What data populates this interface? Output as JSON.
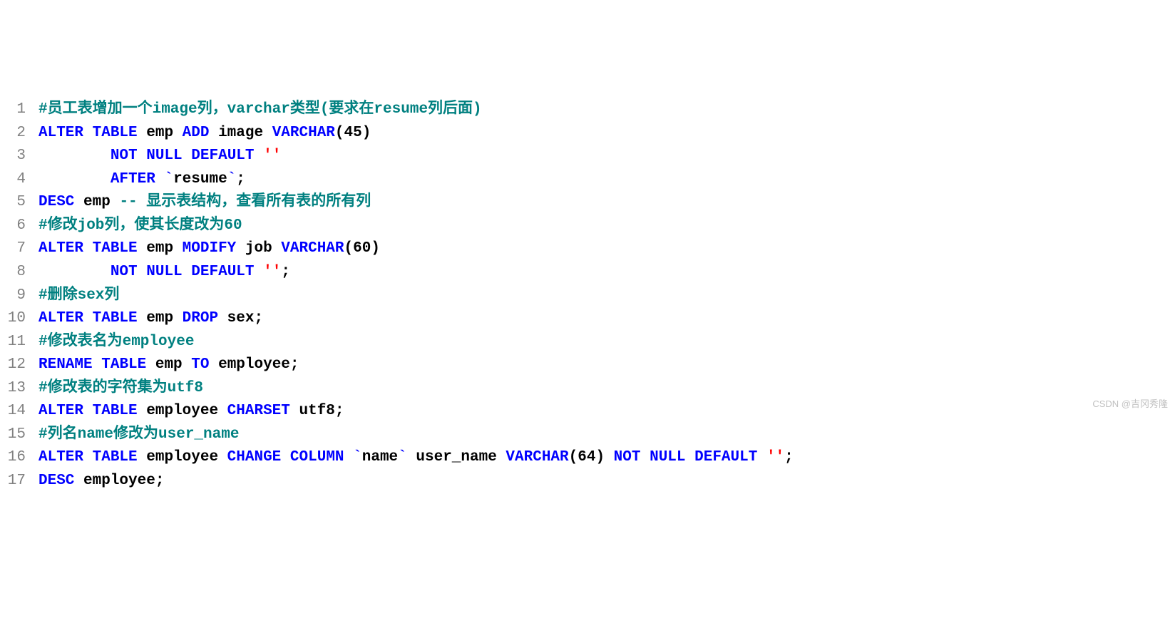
{
  "watermark": "CSDN @吉冈秀隆",
  "lines": [
    {
      "n": "1",
      "tokens": [
        {
          "c": "cmt",
          "t": "#员工表增加一个image列，varchar类型(要求在resume列后面)"
        }
      ]
    },
    {
      "n": "2",
      "tokens": [
        {
          "c": "kw",
          "t": "ALTER"
        },
        {
          "c": "txt",
          "t": " "
        },
        {
          "c": "kw",
          "t": "TABLE"
        },
        {
          "c": "txt",
          "t": " emp "
        },
        {
          "c": "kw",
          "t": "ADD"
        },
        {
          "c": "txt",
          "t": " image "
        },
        {
          "c": "kw",
          "t": "VARCHAR"
        },
        {
          "c": "txt",
          "t": "("
        },
        {
          "c": "num",
          "t": "45"
        },
        {
          "c": "txt",
          "t": ")"
        }
      ]
    },
    {
      "n": "3",
      "tokens": [
        {
          "c": "txt",
          "t": "        "
        },
        {
          "c": "kw",
          "t": "NOT"
        },
        {
          "c": "txt",
          "t": " "
        },
        {
          "c": "kw",
          "t": "NULL"
        },
        {
          "c": "txt",
          "t": " "
        },
        {
          "c": "kw",
          "t": "DEFAULT"
        },
        {
          "c": "txt",
          "t": " "
        },
        {
          "c": "str",
          "t": "''"
        }
      ]
    },
    {
      "n": "4",
      "tokens": [
        {
          "c": "txt",
          "t": "        "
        },
        {
          "c": "kw",
          "t": "AFTER"
        },
        {
          "c": "txt",
          "t": " "
        },
        {
          "c": "bk",
          "t": "`"
        },
        {
          "c": "txt",
          "t": "resume"
        },
        {
          "c": "bk",
          "t": "`"
        },
        {
          "c": "txt",
          "t": ";"
        }
      ]
    },
    {
      "n": "5",
      "tokens": [
        {
          "c": "kw",
          "t": "DESC"
        },
        {
          "c": "txt",
          "t": " emp "
        },
        {
          "c": "cmt",
          "t": "-- 显示表结构，查看所有表的所有列"
        }
      ]
    },
    {
      "n": "6",
      "tokens": [
        {
          "c": "cmt",
          "t": "#修改job列，使其长度改为60"
        }
      ]
    },
    {
      "n": "7",
      "tokens": [
        {
          "c": "kw",
          "t": "ALTER"
        },
        {
          "c": "txt",
          "t": " "
        },
        {
          "c": "kw",
          "t": "TABLE"
        },
        {
          "c": "txt",
          "t": " emp "
        },
        {
          "c": "kw",
          "t": "MODIFY"
        },
        {
          "c": "txt",
          "t": " job "
        },
        {
          "c": "kw",
          "t": "VARCHAR"
        },
        {
          "c": "txt",
          "t": "("
        },
        {
          "c": "num",
          "t": "60"
        },
        {
          "c": "txt",
          "t": ")"
        }
      ]
    },
    {
      "n": "8",
      "tokens": [
        {
          "c": "txt",
          "t": "        "
        },
        {
          "c": "kw",
          "t": "NOT"
        },
        {
          "c": "txt",
          "t": " "
        },
        {
          "c": "kw",
          "t": "NULL"
        },
        {
          "c": "txt",
          "t": " "
        },
        {
          "c": "kw",
          "t": "DEFAULT"
        },
        {
          "c": "txt",
          "t": " "
        },
        {
          "c": "str",
          "t": "''"
        },
        {
          "c": "txt",
          "t": ";"
        }
      ]
    },
    {
      "n": "9",
      "tokens": [
        {
          "c": "cmt",
          "t": "#删除sex列"
        }
      ]
    },
    {
      "n": "10",
      "tokens": [
        {
          "c": "kw",
          "t": "ALTER"
        },
        {
          "c": "txt",
          "t": " "
        },
        {
          "c": "kw",
          "t": "TABLE"
        },
        {
          "c": "txt",
          "t": " emp "
        },
        {
          "c": "kw",
          "t": "DROP"
        },
        {
          "c": "txt",
          "t": " sex;"
        }
      ]
    },
    {
      "n": "11",
      "tokens": [
        {
          "c": "cmt",
          "t": "#修改表名为employee"
        }
      ]
    },
    {
      "n": "12",
      "tokens": [
        {
          "c": "kw",
          "t": "RENAME"
        },
        {
          "c": "txt",
          "t": " "
        },
        {
          "c": "kw",
          "t": "TABLE"
        },
        {
          "c": "txt",
          "t": " emp "
        },
        {
          "c": "kw",
          "t": "TO"
        },
        {
          "c": "txt",
          "t": " employee;"
        }
      ]
    },
    {
      "n": "13",
      "tokens": [
        {
          "c": "cmt",
          "t": "#修改表的字符集为utf8"
        }
      ]
    },
    {
      "n": "14",
      "tokens": [
        {
          "c": "kw",
          "t": "ALTER"
        },
        {
          "c": "txt",
          "t": " "
        },
        {
          "c": "kw",
          "t": "TABLE"
        },
        {
          "c": "txt",
          "t": " employee "
        },
        {
          "c": "kw",
          "t": "CHARSET"
        },
        {
          "c": "txt",
          "t": " utf8;"
        }
      ]
    },
    {
      "n": "15",
      "tokens": [
        {
          "c": "cmt",
          "t": "#列名name修改为user_name"
        }
      ]
    },
    {
      "n": "16",
      "tokens": [
        {
          "c": "kw",
          "t": "ALTER"
        },
        {
          "c": "txt",
          "t": " "
        },
        {
          "c": "kw",
          "t": "TABLE"
        },
        {
          "c": "txt",
          "t": " employee "
        },
        {
          "c": "kw",
          "t": "CHANGE"
        },
        {
          "c": "txt",
          "t": " "
        },
        {
          "c": "kw",
          "t": "COLUMN"
        },
        {
          "c": "txt",
          "t": " "
        },
        {
          "c": "bk",
          "t": "`"
        },
        {
          "c": "txt",
          "t": "name"
        },
        {
          "c": "bk",
          "t": "`"
        },
        {
          "c": "txt",
          "t": " user_name "
        },
        {
          "c": "kw",
          "t": "VARCHAR"
        },
        {
          "c": "txt",
          "t": "("
        },
        {
          "c": "num",
          "t": "64"
        },
        {
          "c": "txt",
          "t": ") "
        },
        {
          "c": "kw",
          "t": "NOT"
        },
        {
          "c": "txt",
          "t": " "
        },
        {
          "c": "kw",
          "t": "NULL"
        },
        {
          "c": "txt",
          "t": " "
        },
        {
          "c": "kw",
          "t": "DEFAULT"
        },
        {
          "c": "txt",
          "t": " "
        },
        {
          "c": "str",
          "t": "''"
        },
        {
          "c": "txt",
          "t": ";"
        }
      ]
    },
    {
      "n": "17",
      "tokens": [
        {
          "c": "kw",
          "t": "DESC"
        },
        {
          "c": "txt",
          "t": " employee;"
        }
      ]
    }
  ]
}
